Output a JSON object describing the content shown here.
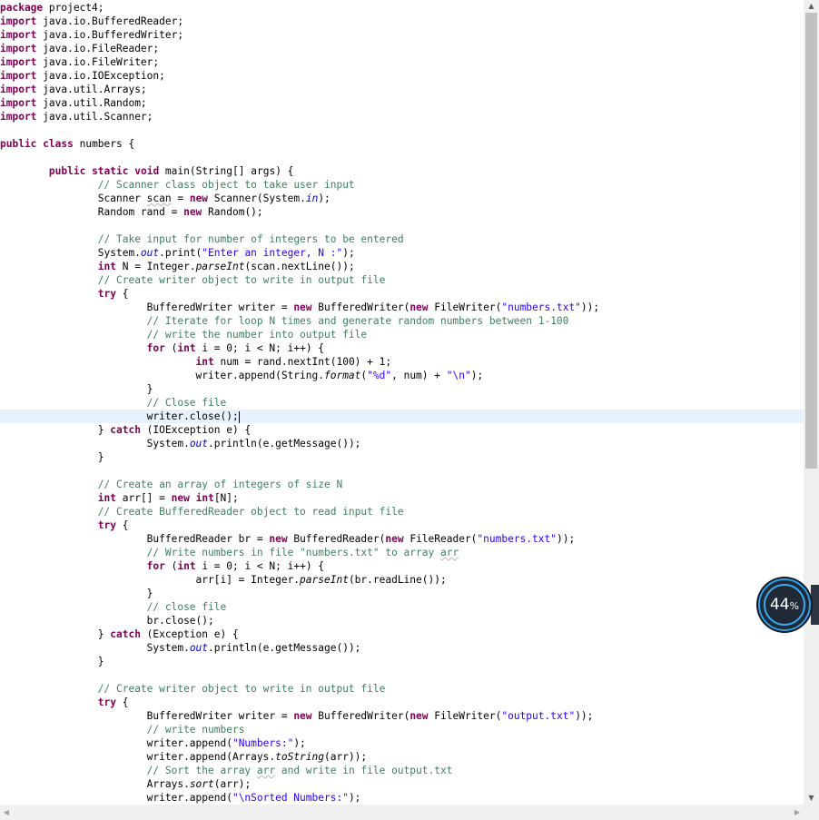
{
  "editor": {
    "lines": [
      [
        {
          "t": "package",
          "c": "kw"
        },
        {
          "t": " project4;"
        }
      ],
      [
        {
          "t": "import",
          "c": "kw"
        },
        {
          "t": " java.io.BufferedReader;"
        }
      ],
      [
        {
          "t": "import",
          "c": "kw"
        },
        {
          "t": " java.io.BufferedWriter;"
        }
      ],
      [
        {
          "t": "import",
          "c": "kw"
        },
        {
          "t": " java.io.FileReader;"
        }
      ],
      [
        {
          "t": "import",
          "c": "kw"
        },
        {
          "t": " java.io.FileWriter;"
        }
      ],
      [
        {
          "t": "import",
          "c": "kw"
        },
        {
          "t": " java.io.IOException;"
        }
      ],
      [
        {
          "t": "import",
          "c": "kw"
        },
        {
          "t": " java.util.Arrays;"
        }
      ],
      [
        {
          "t": "import",
          "c": "kw"
        },
        {
          "t": " java.util.Random;"
        }
      ],
      [
        {
          "t": "import",
          "c": "kw"
        },
        {
          "t": " java.util.Scanner;"
        }
      ],
      [],
      [
        {
          "t": "public",
          "c": "kw"
        },
        {
          "t": " "
        },
        {
          "t": "class",
          "c": "kw"
        },
        {
          "t": " numbers {"
        }
      ],
      [],
      [
        {
          "t": "        "
        },
        {
          "t": "public",
          "c": "kw"
        },
        {
          "t": " "
        },
        {
          "t": "static",
          "c": "kw"
        },
        {
          "t": " "
        },
        {
          "t": "void",
          "c": "kw"
        },
        {
          "t": " main(String[] "
        },
        {
          "t": "args",
          "c": "plain"
        },
        {
          "t": ") {"
        }
      ],
      [
        {
          "t": "                "
        },
        {
          "t": "// Scanner class object to take user input",
          "c": "cm"
        }
      ],
      [
        {
          "t": "                Scanner "
        },
        {
          "t": "scan",
          "c": "un"
        },
        {
          "t": " = "
        },
        {
          "t": "new",
          "c": "kw"
        },
        {
          "t": " Scanner(System."
        },
        {
          "t": "in",
          "c": "fld"
        },
        {
          "t": ");"
        }
      ],
      [
        {
          "t": "                Random rand = "
        },
        {
          "t": "new",
          "c": "kw"
        },
        {
          "t": " Random();"
        }
      ],
      [],
      [
        {
          "t": "                "
        },
        {
          "t": "// Take input for number of integers to be entered",
          "c": "cm"
        }
      ],
      [
        {
          "t": "                System."
        },
        {
          "t": "out",
          "c": "fld"
        },
        {
          "t": ".print("
        },
        {
          "t": "\"Enter an integer, N :\"",
          "c": "st"
        },
        {
          "t": ");"
        }
      ],
      [
        {
          "t": "                "
        },
        {
          "t": "int",
          "c": "kw"
        },
        {
          "t": " N = Integer."
        },
        {
          "t": "parseInt",
          "c": "it"
        },
        {
          "t": "(scan.nextLine());"
        }
      ],
      [
        {
          "t": "                "
        },
        {
          "t": "// Create writer object to write in output file",
          "c": "cm"
        }
      ],
      [
        {
          "t": "                "
        },
        {
          "t": "try",
          "c": "kw"
        },
        {
          "t": " {"
        }
      ],
      [
        {
          "t": "                        BufferedWriter writer = "
        },
        {
          "t": "new",
          "c": "kw"
        },
        {
          "t": " BufferedWriter("
        },
        {
          "t": "new",
          "c": "kw"
        },
        {
          "t": " FileWriter("
        },
        {
          "t": "\"numbers.txt\"",
          "c": "st"
        },
        {
          "t": "));"
        }
      ],
      [
        {
          "t": "                        "
        },
        {
          "t": "// Iterate for loop N times and generate random numbers between 1-100",
          "c": "cm"
        }
      ],
      [
        {
          "t": "                        "
        },
        {
          "t": "// write the number into output file",
          "c": "cm"
        }
      ],
      [
        {
          "t": "                        "
        },
        {
          "t": "for",
          "c": "kw"
        },
        {
          "t": " ("
        },
        {
          "t": "int",
          "c": "kw"
        },
        {
          "t": " i = 0; i < N; i++) {"
        }
      ],
      [
        {
          "t": "                                "
        },
        {
          "t": "int",
          "c": "kw"
        },
        {
          "t": " num = rand.nextInt(100) + 1;"
        }
      ],
      [
        {
          "t": "                                writer.append(String."
        },
        {
          "t": "format",
          "c": "it"
        },
        {
          "t": "("
        },
        {
          "t": "\"%d\"",
          "c": "st"
        },
        {
          "t": ", num) + "
        },
        {
          "t": "\"\\n\"",
          "c": "st"
        },
        {
          "t": ");"
        }
      ],
      [
        {
          "t": "                        }"
        }
      ],
      [
        {
          "t": "                        "
        },
        {
          "t": "// Close file",
          "c": "cm"
        }
      ],
      [
        {
          "t": "                        writer.close();"
        },
        {
          "t": "",
          "c": "caret"
        }
      ],
      [
        {
          "t": "                } "
        },
        {
          "t": "catch",
          "c": "kw"
        },
        {
          "t": " (IOException e) {"
        }
      ],
      [
        {
          "t": "                        System."
        },
        {
          "t": "out",
          "c": "fld"
        },
        {
          "t": ".println(e.getMessage());"
        }
      ],
      [
        {
          "t": "                }"
        }
      ],
      [],
      [
        {
          "t": "                "
        },
        {
          "t": "// Create an array of integers of size N",
          "c": "cm"
        }
      ],
      [
        {
          "t": "                "
        },
        {
          "t": "int",
          "c": "kw"
        },
        {
          "t": " arr[] = "
        },
        {
          "t": "new",
          "c": "kw"
        },
        {
          "t": " "
        },
        {
          "t": "int",
          "c": "kw"
        },
        {
          "t": "[N];"
        }
      ],
      [
        {
          "t": "                "
        },
        {
          "t": "// Create BufferedReader object to read input file",
          "c": "cm"
        }
      ],
      [
        {
          "t": "                "
        },
        {
          "t": "try",
          "c": "kw"
        },
        {
          "t": " {"
        }
      ],
      [
        {
          "t": "                        BufferedReader br = "
        },
        {
          "t": "new",
          "c": "kw"
        },
        {
          "t": " BufferedReader("
        },
        {
          "t": "new",
          "c": "kw"
        },
        {
          "t": " FileReader("
        },
        {
          "t": "\"numbers.txt\"",
          "c": "st"
        },
        {
          "t": "));"
        }
      ],
      [
        {
          "t": "                        "
        },
        {
          "t": "// Write numbers in file \"numbers.txt\" to array ",
          "c": "cm"
        },
        {
          "t": "arr",
          "c": "cm un"
        }
      ],
      [
        {
          "t": "                        "
        },
        {
          "t": "for",
          "c": "kw"
        },
        {
          "t": " ("
        },
        {
          "t": "int",
          "c": "kw"
        },
        {
          "t": " i = 0; i < N; i++) {"
        }
      ],
      [
        {
          "t": "                                arr[i] = Integer."
        },
        {
          "t": "parseInt",
          "c": "it"
        },
        {
          "t": "(br.readLine());"
        }
      ],
      [
        {
          "t": "                        }"
        }
      ],
      [
        {
          "t": "                        "
        },
        {
          "t": "// close file",
          "c": "cm"
        }
      ],
      [
        {
          "t": "                        br.close();"
        }
      ],
      [
        {
          "t": "                } "
        },
        {
          "t": "catch",
          "c": "kw"
        },
        {
          "t": " (Exception e) {"
        }
      ],
      [
        {
          "t": "                        System."
        },
        {
          "t": "out",
          "c": "fld"
        },
        {
          "t": ".println(e.getMessage());"
        }
      ],
      [
        {
          "t": "                }"
        }
      ],
      [],
      [
        {
          "t": "                "
        },
        {
          "t": "// Create writer object to write in output file",
          "c": "cm"
        }
      ],
      [
        {
          "t": "                "
        },
        {
          "t": "try",
          "c": "kw"
        },
        {
          "t": " {"
        }
      ],
      [
        {
          "t": "                        BufferedWriter writer = "
        },
        {
          "t": "new",
          "c": "kw"
        },
        {
          "t": " BufferedWriter("
        },
        {
          "t": "new",
          "c": "kw"
        },
        {
          "t": " FileWriter("
        },
        {
          "t": "\"output.txt\"",
          "c": "st"
        },
        {
          "t": "));"
        }
      ],
      [
        {
          "t": "                        "
        },
        {
          "t": "// write numbers",
          "c": "cm"
        }
      ],
      [
        {
          "t": "                        writer.append("
        },
        {
          "t": "\"Numbers:\"",
          "c": "st"
        },
        {
          "t": ");"
        }
      ],
      [
        {
          "t": "                        writer.append(Arrays."
        },
        {
          "t": "toString",
          "c": "it"
        },
        {
          "t": "(arr));"
        }
      ],
      [
        {
          "t": "                        "
        },
        {
          "t": "// Sort the array ",
          "c": "cm"
        },
        {
          "t": "arr",
          "c": "cm un"
        },
        {
          "t": " and write in file output.txt",
          "c": "cm"
        }
      ],
      [
        {
          "t": "                        Arrays."
        },
        {
          "t": "sort",
          "c": "it"
        },
        {
          "t": "(arr);"
        }
      ],
      [
        {
          "t": "                        writer.append("
        },
        {
          "t": "\"\\nSorted Numbers:\"",
          "c": "st"
        },
        {
          "t": ");"
        }
      ]
    ],
    "current_line": 30
  },
  "scrollbars": {
    "up_icon": "▲",
    "down_icon": "▼",
    "left_icon": "◀",
    "right_icon": "▶"
  },
  "zoom_badge": {
    "value": "44",
    "unit": "%"
  },
  "colors": {
    "keyword": "#7f0055",
    "comment": "#3f7f5f",
    "string": "#2a00ff",
    "field": "#0000c0",
    "current_line": "#e8f2fe"
  }
}
